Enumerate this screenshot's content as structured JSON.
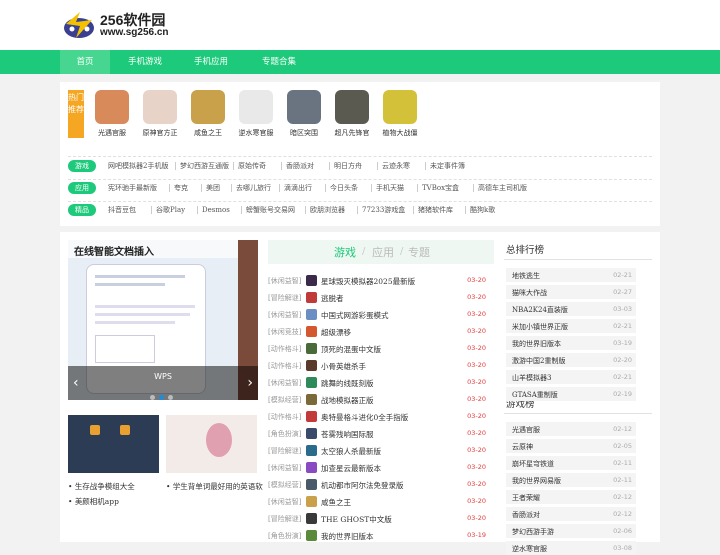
{
  "header": {
    "logo_title": "256软件园",
    "logo_url": "www.sg256.cn"
  },
  "nav": [
    {
      "label": "首页",
      "active": true
    },
    {
      "label": "手机游戏",
      "active": false
    },
    {
      "label": "手机应用",
      "active": false
    },
    {
      "label": "专题合集",
      "active": false
    }
  ],
  "hot": {
    "badge": "热门推荐",
    "apps": [
      {
        "name": "光遇官服",
        "color": "#d98a5a"
      },
      {
        "name": "原神官方正",
        "color": "#e8d3c9"
      },
      {
        "name": "咸鱼之王",
        "color": "#c9a14a"
      },
      {
        "name": "逆水寒官服",
        "color": "#e9e9e9"
      },
      {
        "name": "暗区突围",
        "color": "#6a7480"
      },
      {
        "name": "超凡先锋官",
        "color": "#5a5a50"
      },
      {
        "name": "植物大战僵",
        "color": "#d4c13a"
      }
    ]
  },
  "tag_rows": [
    {
      "label": "游戏",
      "links": [
        "网吧模拟器2手机版",
        "梦幻西游互通版",
        "原始传奇",
        "香肠派对",
        "明日方舟",
        "云迹永寒",
        "未定事件簿"
      ]
    },
    {
      "label": "应用",
      "links": [
        "宪环驰手最新版",
        "夸克",
        "美团",
        "去哪儿旅行",
        "滴滴出行",
        "今日头条",
        "手机天猫",
        "TVBox宝盒",
        "高德车主司机版"
      ]
    },
    {
      "label": "精品",
      "links": [
        "抖音豆包",
        "谷歌Play",
        "Desmos",
        "螃蟹账号交易网",
        "欧朋浏览器",
        "77233游戏盒",
        "猪猪软件库",
        "酷狗k歌"
      ]
    }
  ],
  "slider": {
    "title": "在线智能文档插入",
    "caption": "WPS",
    "prev_icon": "chevron-left-icon",
    "next_icon": "chevron-right-icon"
  },
  "thumbs": [
    {
      "caption": "生存战争模组大全",
      "color": "#2d3c55"
    },
    {
      "caption": "学生背单词最好用的英语软",
      "color": "#f3ebe8"
    }
  ],
  "thumb_extra": "美颜相机app",
  "list_tabs": [
    "游戏",
    "应用",
    "专题"
  ],
  "list_items": [
    {
      "cat": "[休闲益智]",
      "name": "星球毁灭模拟器2025最新版",
      "date": "03-20",
      "color": "#3b2a4a"
    },
    {
      "cat": "[冒险解谜]",
      "name": "逃脱者",
      "date": "03-20",
      "color": "#c03a3a"
    },
    {
      "cat": "[休闲益智]",
      "name": "中国式网游彩蛋模式",
      "date": "03-20",
      "color": "#6b8fc2"
    },
    {
      "cat": "[休闲竞技]",
      "name": "超级漂移",
      "date": "03-20",
      "color": "#d4582e"
    },
    {
      "cat": "[动作格斗]",
      "name": "顶死的混蛋中文版",
      "date": "03-20",
      "color": "#4a6a3a"
    },
    {
      "cat": "[动作格斗]",
      "name": "小骨英雄杀手",
      "date": "03-20",
      "color": "#5a3a2a"
    },
    {
      "cat": "[休闲益智]",
      "name": "跳舞的线既刻版",
      "date": "03-20",
      "color": "#2e8a5a"
    },
    {
      "cat": "[模拟经营]",
      "name": "战地模拟器正版",
      "date": "03-20",
      "color": "#7a6a3a"
    },
    {
      "cat": "[动作格斗]",
      "name": "奥特曼格斗进化0全手指版",
      "date": "03-20",
      "color": "#c23a3a"
    },
    {
      "cat": "[角色扮演]",
      "name": "苍雾残响国际服",
      "date": "03-20",
      "color": "#3a4a6a"
    },
    {
      "cat": "[冒险解谜]",
      "name": "太空狼人杀最新版",
      "date": "03-20",
      "color": "#2a6a8a"
    },
    {
      "cat": "[休闲益智]",
      "name": "加查星云最新版本",
      "date": "03-20",
      "color": "#8a4ac2"
    },
    {
      "cat": "[模拟经营]",
      "name": "机动都市阿尔法免登录版",
      "date": "03-20",
      "color": "#4a5a6a"
    },
    {
      "cat": "[休闲益智]",
      "name": "咸鱼之王",
      "date": "03-20",
      "color": "#c9a14a"
    },
    {
      "cat": "[冒险解谜]",
      "name": "THE GHOST中文版",
      "date": "03-20",
      "color": "#3a3a3a"
    },
    {
      "cat": "[角色扮演]",
      "name": "我的世界旧版本",
      "date": "03-19",
      "color": "#5a8a3a"
    }
  ],
  "rank_total": {
    "title": "总排行榜",
    "items": [
      {
        "name": "地铁逃生",
        "date": "02-21"
      },
      {
        "name": "猫咪大作战",
        "date": "02-27"
      },
      {
        "name": "NBA2K24直装版",
        "date": "03-03"
      },
      {
        "name": "米加小镇世界正版",
        "date": "02-21"
      },
      {
        "name": "我的世界旧版本",
        "date": "03-19"
      },
      {
        "name": "激游中国2重制版",
        "date": "02-20"
      },
      {
        "name": "山羊模拟器3",
        "date": "02-21"
      },
      {
        "name": "GTASA重制版",
        "date": "02-19"
      }
    ]
  },
  "rank_game": {
    "title": "游戏榜",
    "items": [
      {
        "name": "光遇官服",
        "date": "02-12"
      },
      {
        "name": "云原神",
        "date": "02-05"
      },
      {
        "name": "崩坏星穹铁道",
        "date": "02-11"
      },
      {
        "name": "我的世界网易版",
        "date": "02-11"
      },
      {
        "name": "王者荣耀",
        "date": "02-12"
      },
      {
        "name": "香肠派对",
        "date": "02-12"
      },
      {
        "name": "梦幻西游手游",
        "date": "02-06"
      },
      {
        "name": "逆水寒官服",
        "date": "03-08"
      }
    ]
  }
}
